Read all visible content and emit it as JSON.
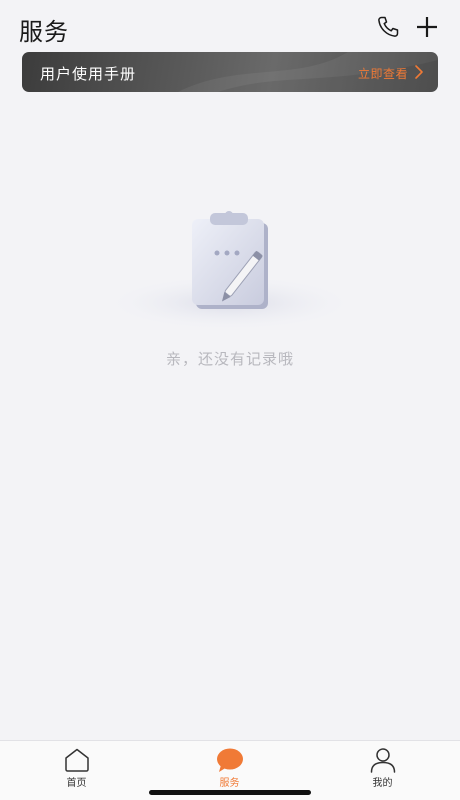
{
  "header": {
    "title": "服务",
    "phone_icon": "phone-icon",
    "add_icon": "plus-icon"
  },
  "banner": {
    "title": "用户使用手册",
    "cta": "立即查看",
    "cta_color": "#f07a36"
  },
  "empty_state": {
    "illustration": "clipboard-pencil-illustration",
    "message": "亲，还没有记录哦"
  },
  "tabbar": {
    "tabs": [
      {
        "label": "首页",
        "icon": "home-icon",
        "active": false
      },
      {
        "label": "服务",
        "icon": "chat-bubble-icon",
        "active": true
      },
      {
        "label": "我的",
        "icon": "user-icon",
        "active": false
      }
    ]
  },
  "colors": {
    "accent": "#f07a36",
    "background": "#f3f3f6"
  }
}
